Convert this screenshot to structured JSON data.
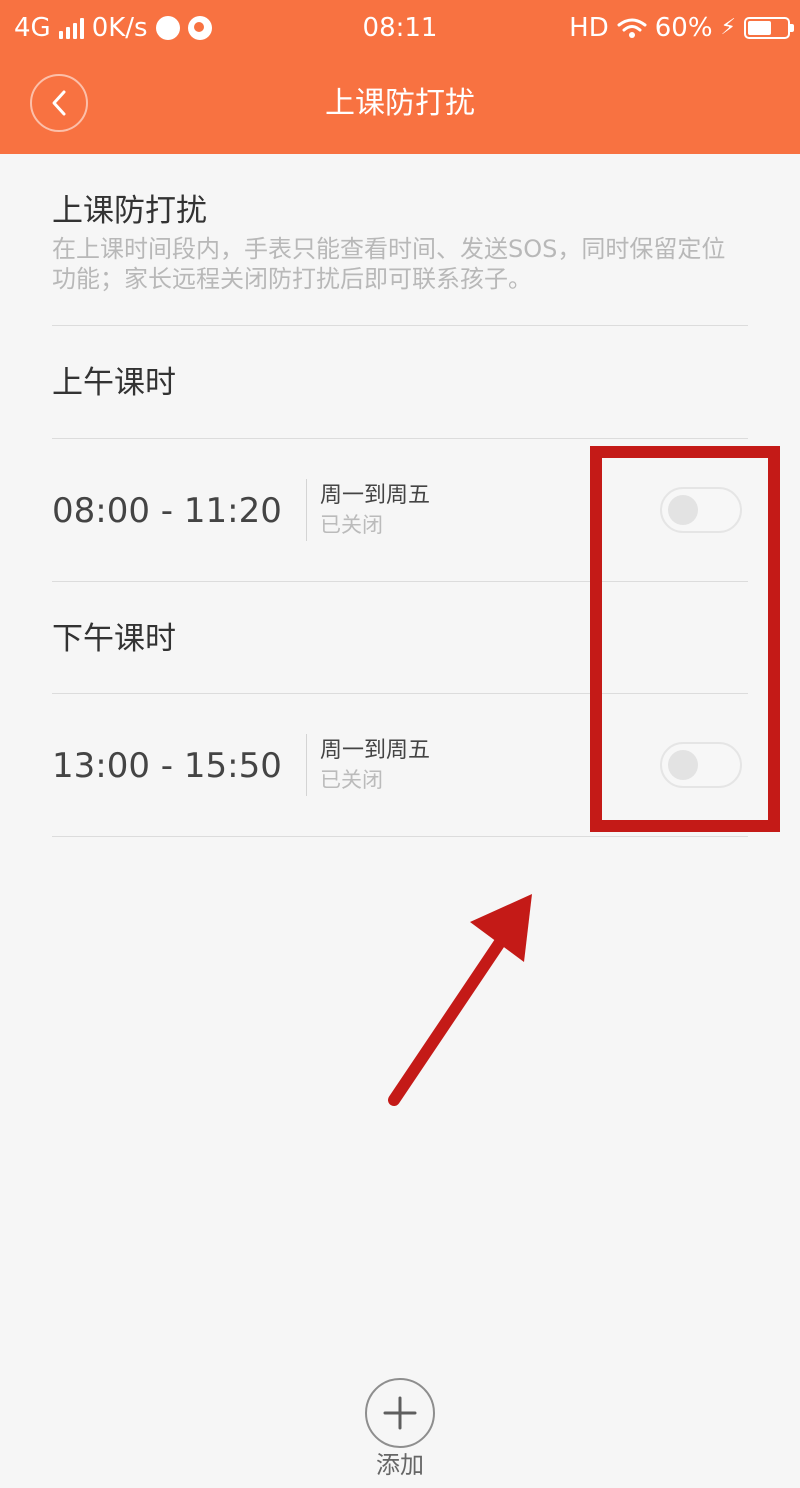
{
  "status_bar": {
    "network": "4G",
    "speed": "0K/s",
    "time": "08:11",
    "hd": "HD",
    "battery": "60%",
    "battery_level": 0.6
  },
  "header": {
    "title": "上课防打扰",
    "icons": {
      "back": "back-icon"
    },
    "colors": {
      "brand": "#f87241"
    }
  },
  "main": {
    "title": "上课防打扰",
    "description": "在上课时间段内，手表只能查看时间、发送SOS，同时保留定位功能；家长远程关闭防打扰后即可联系孩子。"
  },
  "sections": [
    {
      "title": "上午课时",
      "schedule": {
        "time_range": "08:00  -  11:20",
        "days": "周一到周五",
        "status": "已关闭",
        "enabled": false
      }
    },
    {
      "title": "下午课时",
      "schedule": {
        "time_range": "13:00  -  15:50",
        "days": "周一到周五",
        "status": "已关闭",
        "enabled": false
      }
    }
  ],
  "footer": {
    "add_label": "添加",
    "icons": {
      "add": "plus-icon"
    }
  },
  "overlays": {
    "highlight_color": "#c41a17",
    "arrow_color": "#c41a17"
  }
}
